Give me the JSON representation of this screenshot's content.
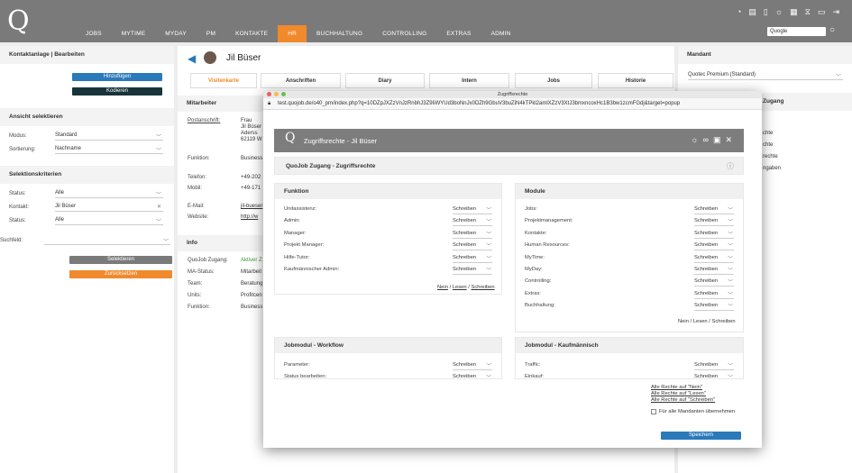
{
  "header": {
    "logo": "Q",
    "nav": [
      "JOBS",
      "MYTIME",
      "MYDAY",
      "PM",
      "KONTAKTE",
      "HR",
      "BUCHHALTUNG",
      "CONTROLLING",
      "EXTRAS",
      "ADMIN"
    ],
    "active_index": 5,
    "search_value": "Quogle",
    "accent": "#f08a2c"
  },
  "left": {
    "title": "Kontaktanlage | Bearbeiten",
    "add_btn": "Hinzufügen",
    "code_btn": "Kodieren",
    "view_title": "Ansicht selektieren",
    "modus_label": "Modus:",
    "modus_val": "Standard",
    "sort_label": "Sortierung:",
    "sort_val": "Nachname",
    "sel_title": "Selektionskriterien",
    "status_label": "Status:",
    "status_val": "Alle",
    "kontakt_label": "Kontakt:",
    "kontakt_val": "Jil  Büser",
    "status2_label": "Status:",
    "status2_val": "Alle",
    "suchfeld_label": "Suchfeld:",
    "select_btn": "Selektieren",
    "reset_btn": "Zurücksetzen"
  },
  "center": {
    "name": "Jil Büser",
    "tabs": [
      "Visitenkarte",
      "Anschriften",
      "Diary",
      "Intern",
      "Jobs",
      "Historie"
    ],
    "mitarbeiter": "Mitarbeiter",
    "post_label": "Postanschrift:",
    "post_lines": [
      "Frau",
      "Jil Büser",
      "Aderss",
      "62119 W"
    ],
    "funktion_label": "Funktion:",
    "funktion_val": "Business",
    "telefon_label": "Telefon:",
    "telefon_val": "+49-202",
    "mobil_label": "Mobil:",
    "mobil_val": "+49-171",
    "email_label": "E-Mail:",
    "email_val": "jil-bueser",
    "website_label": "Website:",
    "website_val": "http://w",
    "info_title": "Info",
    "info": [
      {
        "l": "QuoJob Zugang:",
        "v": "Aktiver Z"
      },
      {
        "l": "MA-Status:",
        "v": "Mitarbeit"
      },
      {
        "l": "Team:",
        "v": "Beratung"
      },
      {
        "l": "Units:",
        "v": "Profitcen"
      },
      {
        "l": "Funktion:",
        "v": "Business"
      }
    ]
  },
  "right": {
    "mandant_title": "Mandant",
    "mandant_val": "Quotec Premium (Standard)",
    "zugang_title": "Zugang",
    "zugang_items": [
      "chte",
      "chte",
      "rechte",
      "ngaben"
    ]
  },
  "modal": {
    "window_title": "Zugriffsrechte",
    "url": "test.quojob.de/o40_pm/index.php?q=10DZpJXZzVnJzRnbhJ3Z9IiWYUd3boNnJx0DZh9GbuV3buZiN4kTPkl2amlXZzV3XtJ3bmxncoxHc1B3bw1zcmFGdj&target=popup",
    "header_title": "Zugriffsrechte - Jil Büser",
    "section_title": "QuoJob Zugang - Zugriffsrechte",
    "funktion_title": "Funktion",
    "funktion_rows": [
      {
        "label": "Unitassistenz:",
        "value": "Schreiben"
      },
      {
        "label": "Admin:",
        "value": "Schreiben"
      },
      {
        "label": "Manager:",
        "value": "Schreiben"
      },
      {
        "label": "Projekt Manager:",
        "value": "Schreiben"
      },
      {
        "label": "Hilfe-Tutor:",
        "value": "Schreiben"
      },
      {
        "label": "Kaufmännischer Admin:",
        "value": "Schreiben"
      }
    ],
    "module_title": "Module",
    "module_rows": [
      {
        "label": "Jobs:",
        "value": "Schreiben"
      },
      {
        "label": "Projektmanagement:",
        "value": "Schreiben"
      },
      {
        "label": "Kontakte:",
        "value": "Schreiben"
      },
      {
        "label": "Human Resources:",
        "value": "Schreiben"
      },
      {
        "label": "MyTime:",
        "value": "Schreiben"
      },
      {
        "label": "MyDay:",
        "value": "Schreiben"
      },
      {
        "label": "Controlling:",
        "value": "Schreiben"
      },
      {
        "label": "Extras:",
        "value": "Schreiben"
      },
      {
        "label": "Buchhaltung:",
        "value": "Schreiben"
      }
    ],
    "nein": "Nein",
    "lesen": "Lesen",
    "schreiben": "Schreiben",
    "sep": "/",
    "workflow_title": "Jobmodul - Workflow",
    "workflow_rows": [
      {
        "label": "Parameter:",
        "value": "Schreiben"
      },
      {
        "label": "Status bearbeiten:",
        "value": "Schreiben"
      }
    ],
    "kauf_title": "Jobmodul - Kaufmännisch",
    "kauf_rows": [
      {
        "label": "Traffic:",
        "value": "Schreiben"
      },
      {
        "label": "Einkauf:",
        "value": "Schreiben"
      }
    ],
    "all_nein": "Alle Rechte auf \"Nein\"",
    "all_lesen": "Alle Rechte auf \"Lesen\"",
    "all_schreiben": "Alle Rechte auf \"Schreiben\"",
    "checkbox_label": "Für alle Mandanten übernehmen",
    "save": "Speichern"
  }
}
